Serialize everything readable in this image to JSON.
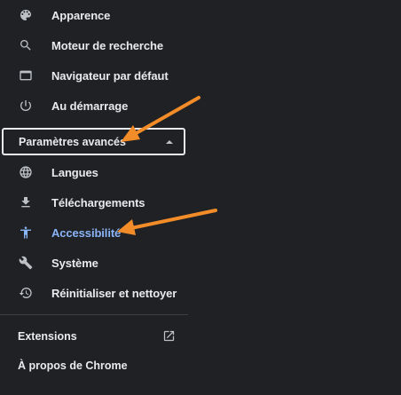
{
  "menu": {
    "items": [
      {
        "label": "Apparence",
        "icon": "palette-icon"
      },
      {
        "label": "Moteur de recherche",
        "icon": "search-icon"
      },
      {
        "label": "Navigateur par défaut",
        "icon": "browser-window-icon"
      },
      {
        "label": "Au démarrage",
        "icon": "power-icon"
      }
    ],
    "advanced": {
      "label": "Paramètres avancés",
      "expanded": true
    },
    "advanced_items": [
      {
        "label": "Langues",
        "icon": "globe-icon"
      },
      {
        "label": "Téléchargements",
        "icon": "download-icon"
      },
      {
        "label": "Accessibilité",
        "icon": "accessibility-icon",
        "active": true
      },
      {
        "label": "Système",
        "icon": "wrench-icon"
      },
      {
        "label": "Réinitialiser et nettoyer",
        "icon": "reset-history-icon"
      }
    ],
    "extensions_label": "Extensions",
    "about_label": "À propos de Chrome"
  },
  "colors": {
    "background": "#202124",
    "text": "#e8eaed",
    "icon": "#bdc1c6",
    "active": "#8ab4f8",
    "annotation_arrow": "#f28c28"
  }
}
